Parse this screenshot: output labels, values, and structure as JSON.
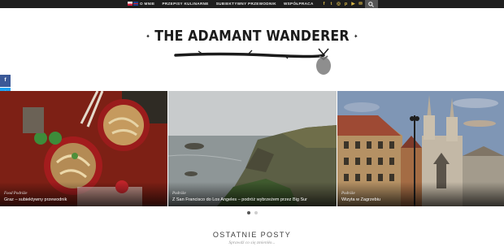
{
  "topbar": {
    "nav": [
      "O MNIE",
      "PRZEPISY KULINARNE",
      "SUBIEKTYWNY PRZEWODNIK",
      "WSPÓŁPRACA"
    ],
    "social_icons": [
      "facebook-icon",
      "twitter-icon",
      "instagram-icon",
      "pinterest-icon",
      "youtube-icon",
      "email-icon"
    ],
    "social_color": "#d9b84a",
    "bar_color": "#1e1e1e"
  },
  "logo": {
    "title": "THE ADAMANT WANDERER"
  },
  "share": [
    {
      "icon": "facebook-icon",
      "color": "#3b5998"
    },
    {
      "icon": "twitter-icon",
      "color": "#1da1f2"
    },
    {
      "icon": "google-plus-icon",
      "color": "#dd4b39"
    },
    {
      "icon": "pinterest-icon",
      "color": "#cb2027"
    },
    {
      "icon": "email-icon",
      "color": "#7d7d7d"
    }
  ],
  "slides": [
    {
      "category": "Food  Podróże",
      "title": "Graz – subiektywny przewodnik"
    },
    {
      "category": "Podróże",
      "title": "Z San Francisco do Los Angeles – podróż wybrzeżem przez Big Sur"
    },
    {
      "category": "Podróże",
      "title": "Wizyta w Zagrzebiu"
    }
  ],
  "slider_dots": {
    "count": 2,
    "active": 0
  },
  "recent": {
    "title": "OSTATNIE POSTY",
    "subtitle": "Sprawdź co się zmieniło..."
  }
}
